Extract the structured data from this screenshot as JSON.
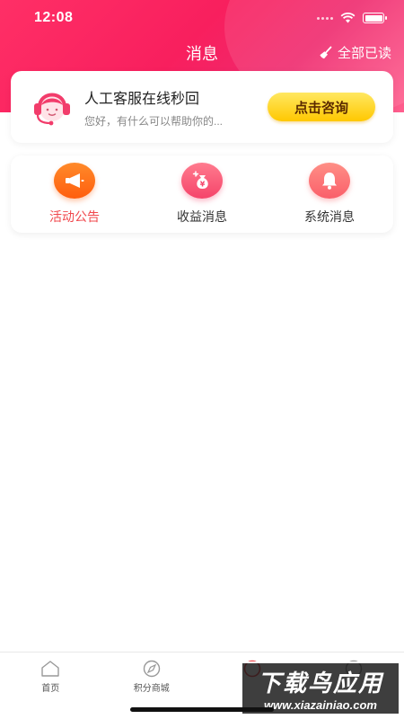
{
  "status_bar": {
    "time": "12:08"
  },
  "header": {
    "title": "消息",
    "mark_all_read": "全部已读",
    "mark_all_icon": "broom-icon"
  },
  "customer_service": {
    "title": "人工客服在线秒回",
    "subtitle": "您好，有什么可以帮助你的...",
    "button": "点击咨询",
    "avatar_icon": "headset-agent-icon"
  },
  "categories": [
    {
      "label": "活动公告",
      "icon": "megaphone-icon",
      "active": true
    },
    {
      "label": "收益消息",
      "icon": "money-bag-icon",
      "active": false
    },
    {
      "label": "系统消息",
      "icon": "bell-icon",
      "active": false
    }
  ],
  "tabbar": {
    "items": [
      {
        "label": "首页",
        "icon": "home-icon"
      },
      {
        "label": "积分商城",
        "icon": "compass-icon"
      },
      {
        "label": "",
        "icon": "message-icon"
      },
      {
        "label": "",
        "icon": "profile-icon"
      }
    ]
  },
  "watermark": {
    "main": "下载鸟应用",
    "sub": "www.xiazainiao.com"
  },
  "colors": {
    "header_red": "#f81f5e",
    "accent_orange": "#ff6a17",
    "active_text": "#f0484d",
    "button_yellow": "#ffd52a"
  }
}
